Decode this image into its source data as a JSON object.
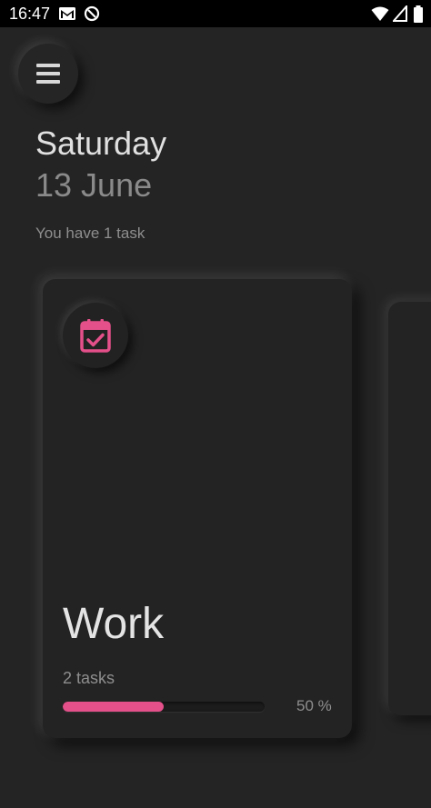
{
  "status_bar": {
    "time": "16:47",
    "icons": [
      "gmail-icon",
      "data-saver-icon",
      "wifi-icon",
      "signal-icon",
      "battery-icon"
    ]
  },
  "header": {
    "menu_icon": "hamburger-menu-icon",
    "day": "Saturday",
    "date": "13 June",
    "summary": "You have 1 task"
  },
  "cards": [
    {
      "icon": "calendar-check-icon",
      "title": "Work",
      "count": "2 tasks",
      "progress": 0.5,
      "progress_label": "50 %"
    }
  ],
  "colors": {
    "accent": "#e4508a",
    "background": "#242424",
    "status_bar": "#000000"
  }
}
